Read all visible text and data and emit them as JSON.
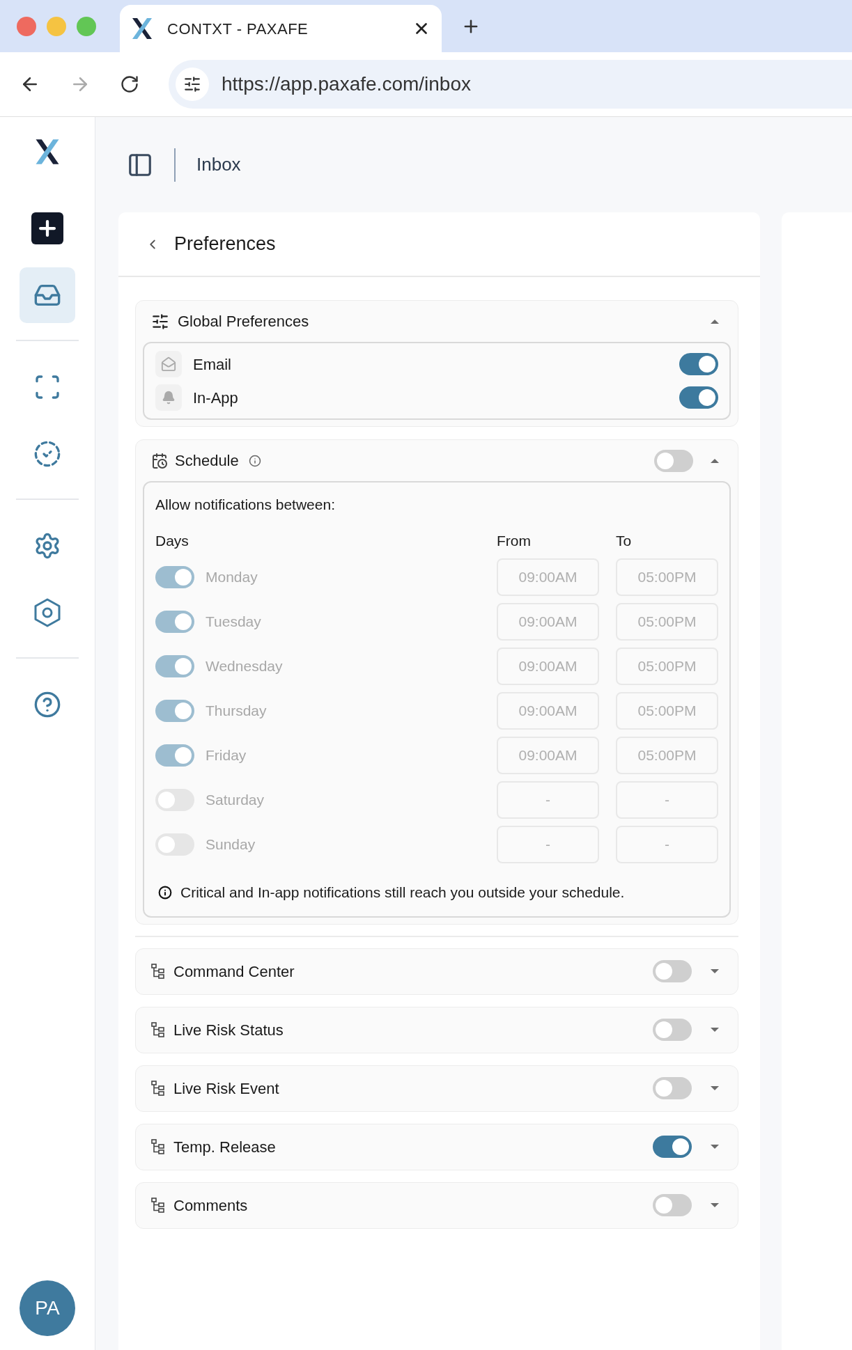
{
  "browser": {
    "tab_title": "CONTXT - PAXAFE",
    "url": "https://app.paxafe.com/inbox"
  },
  "sidebar": {
    "items": [
      {
        "selected": false
      },
      {
        "selected": true
      },
      {
        "selected": false
      },
      {
        "selected": false
      },
      {
        "selected": false
      },
      {
        "selected": false
      },
      {
        "selected": false
      }
    ],
    "avatar": "PA"
  },
  "header": {
    "title": "Inbox"
  },
  "page_title": "Preferences",
  "global_preferences": {
    "title": "Global Preferences",
    "expanded": true,
    "channels": [
      {
        "label": "Email",
        "on": true
      },
      {
        "label": "In-App",
        "on": true
      }
    ]
  },
  "schedule": {
    "title": "Schedule",
    "on": false,
    "expanded": true,
    "intro": "Allow notifications between:",
    "columns": [
      "Days",
      "From",
      "To"
    ],
    "days": [
      {
        "name": "Monday",
        "on": true,
        "from": "09:00AM",
        "to": "05:00PM"
      },
      {
        "name": "Tuesday",
        "on": true,
        "from": "09:00AM",
        "to": "05:00PM"
      },
      {
        "name": "Wednesday",
        "on": true,
        "from": "09:00AM",
        "to": "05:00PM"
      },
      {
        "name": "Thursday",
        "on": true,
        "from": "09:00AM",
        "to": "05:00PM"
      },
      {
        "name": "Friday",
        "on": true,
        "from": "09:00AM",
        "to": "05:00PM"
      },
      {
        "name": "Saturday",
        "on": false,
        "from": "-",
        "to": "-"
      },
      {
        "name": "Sunday",
        "on": false,
        "from": "-",
        "to": "-"
      }
    ],
    "note": "Critical and In-app notifications still reach you outside your schedule."
  },
  "categories": [
    {
      "title": "Command Center",
      "on": false,
      "expanded": false
    },
    {
      "title": "Live Risk Status",
      "on": false,
      "expanded": false
    },
    {
      "title": "Live Risk Event",
      "on": false,
      "expanded": false
    },
    {
      "title": "Temp. Release",
      "on": true,
      "expanded": false
    },
    {
      "title": "Comments",
      "on": false,
      "expanded": false
    }
  ]
}
